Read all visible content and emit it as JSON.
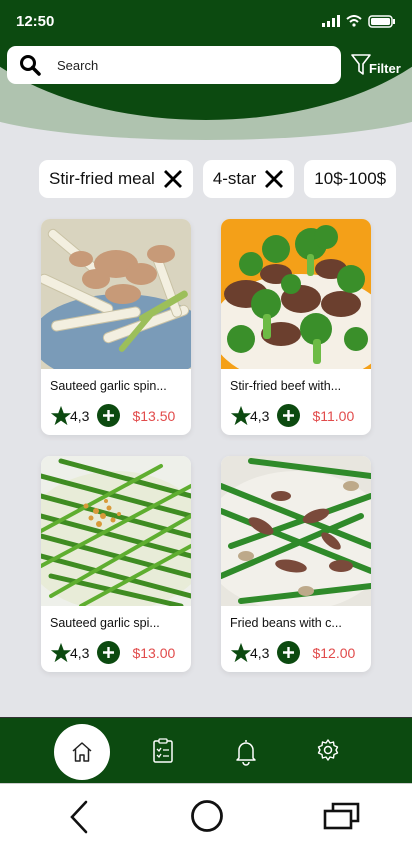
{
  "status": {
    "time": "12:50"
  },
  "search": {
    "placeholder": "Search",
    "filter_label": "Filter"
  },
  "chips": [
    "Stir-fried meal",
    "4-star",
    "10$-100$"
  ],
  "items": [
    {
      "name": "Sauteed garlic spin...",
      "rating": "4,3",
      "price": "$13.50"
    },
    {
      "name": "Stir-fried beef with...",
      "rating": "4,3",
      "price": "$11.00"
    },
    {
      "name": "Sauteed garlic spi...",
      "rating": "4,3",
      "price": "$13.00"
    },
    {
      "name": "Fried beans with c...",
      "rating": "4,3",
      "price": "$12.00"
    }
  ],
  "colors": {
    "brand": "#0c4a10",
    "price": "#e14b4b",
    "background": "#e3e4e8"
  },
  "nav": [
    "home-icon",
    "menu-list-icon",
    "bell-icon",
    "gear-icon"
  ],
  "system_nav": [
    "back-icon",
    "home-circle-icon",
    "recent-apps-icon"
  ]
}
